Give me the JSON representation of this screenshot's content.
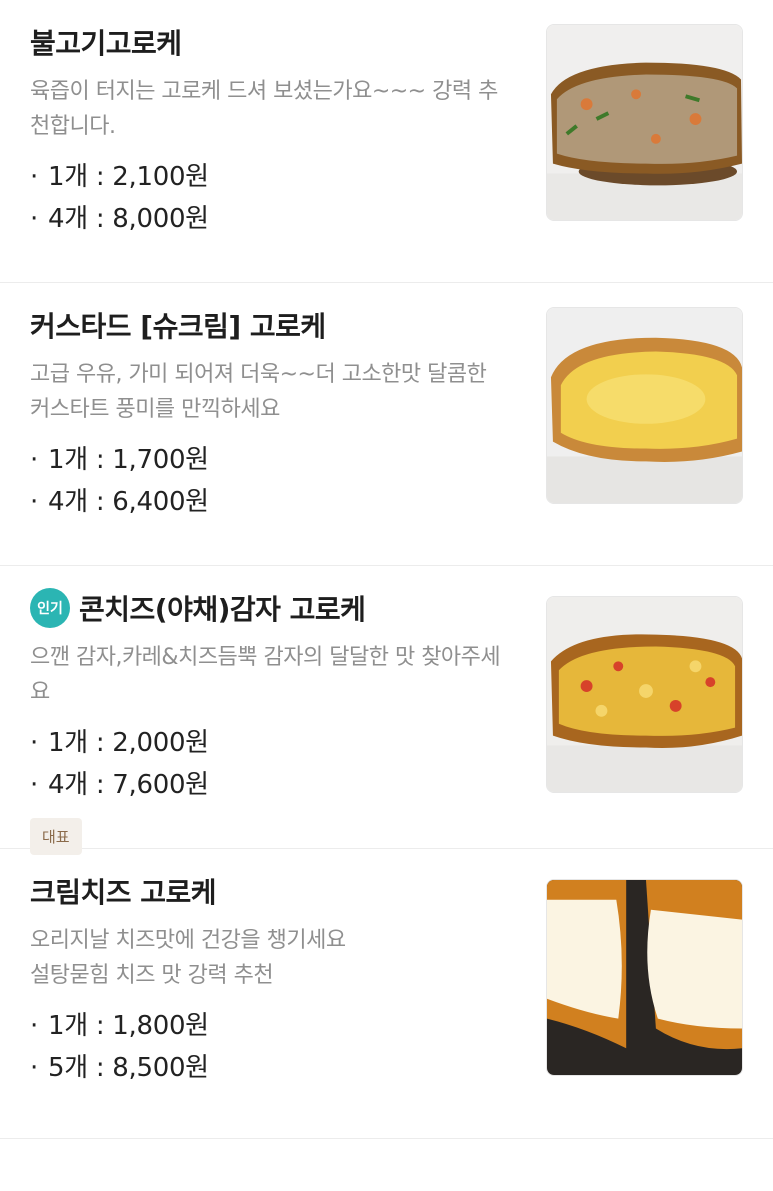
{
  "menu": [
    {
      "title": "불고기고로케",
      "popular": false,
      "description": "육즙이 터지는 고로케 드셔 보셨는가요~~~ 강력 추천합니다.",
      "prices": [
        "1개 : 2,100원",
        "4개 : 8,000원"
      ],
      "tag": "",
      "image_icon": "bulgogi-croquette-photo"
    },
    {
      "title": "커스타드 [슈크림] 고로케",
      "popular": false,
      "description": "고급 우유, 가미 되어져 더욱~~더 고소한맛 달콤한 커스타트 풍미를 만끽하세요",
      "prices": [
        "1개 : 1,700원",
        "4개 : 6,400원"
      ],
      "tag": "",
      "image_icon": "custard-croquette-photo"
    },
    {
      "title": "콘치즈(야채)감자 고로케",
      "popular": true,
      "badge": "인기",
      "description": "으깬 감자,카레&치즈듬뿍 감자의 달달한 맛 찾아주세요",
      "prices": [
        "1개 : 2,000원",
        "4개 : 7,600원"
      ],
      "tag": "대표",
      "image_icon": "corn-cheese-potato-croquette-photo"
    },
    {
      "title": "크림치즈 고로케",
      "popular": false,
      "description": "오리지날 치즈맛에 건강을 챙기세요\n설탕묻힘 치즈 맛 강력 추천",
      "prices": [
        "1개 : 1,800원",
        "5개 : 8,500원"
      ],
      "tag": "",
      "image_icon": "cream-cheese-croquette-photo"
    }
  ],
  "colors": {
    "popular_badge": "#2bb5b3",
    "description": "#8f8f8f",
    "tag_bg": "#f3efea",
    "tag_text": "#8a6a4a"
  }
}
